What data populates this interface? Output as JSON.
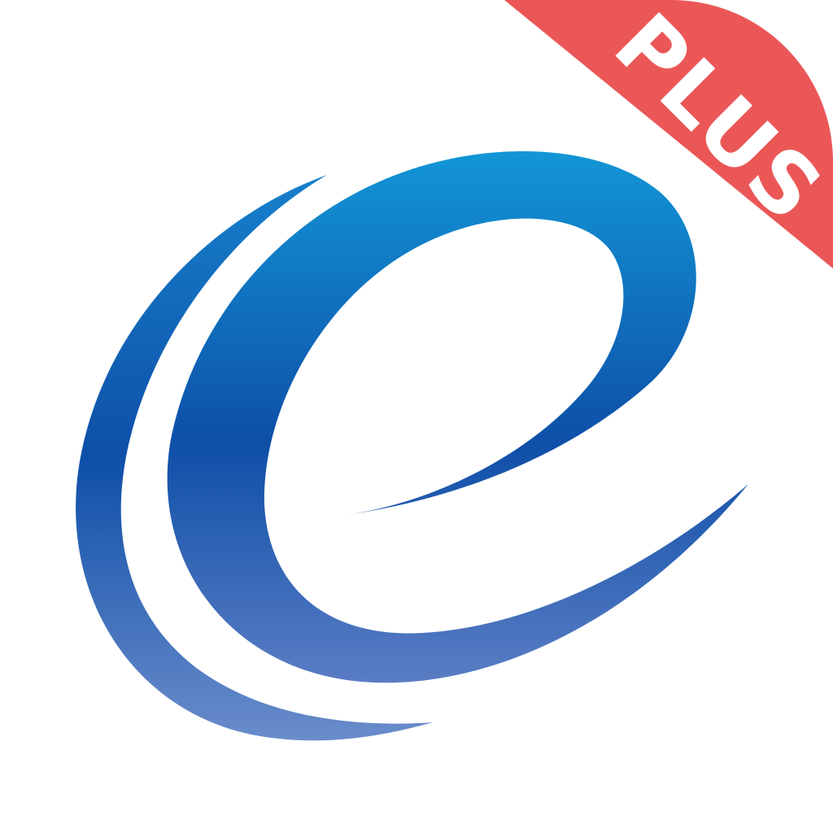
{
  "badge": {
    "label": "PLUS",
    "background_color": "#EB5757",
    "text_color": "#FFFFFF"
  },
  "logo": {
    "icon": "e-swoosh-logo-icon",
    "gradient_top_color": "#1296D6",
    "gradient_mid_color": "#0E4FA8",
    "gradient_bottom_color": "#5A7DC4"
  },
  "background_color": "#FFFFFF"
}
